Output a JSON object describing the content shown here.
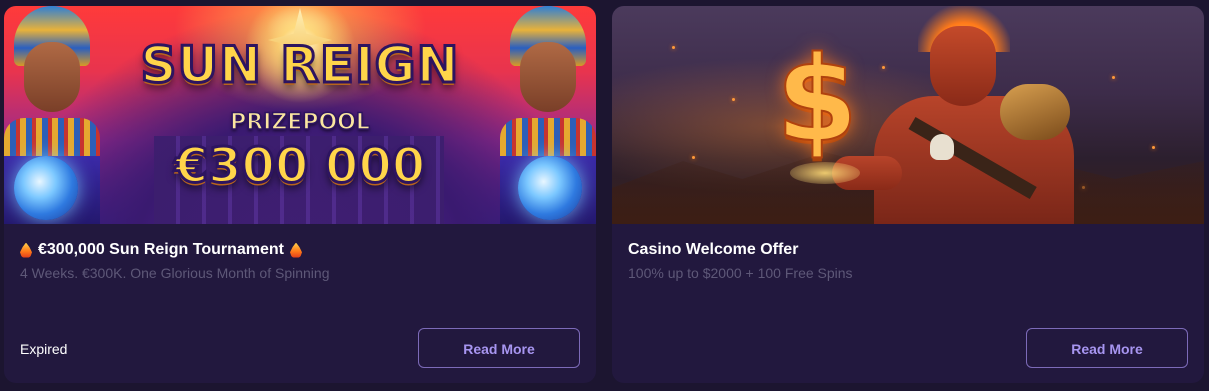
{
  "promotions": [
    {
      "banner": {
        "title": "SUN REIGN",
        "subtitle": "PRIZEPOOL",
        "amount": "€300 000"
      },
      "title": "€300,000 Sun Reign Tournament",
      "description": "4 Weeks. €300K. One Glorious Month of Spinning",
      "status": "Expired",
      "button_label": "Read More",
      "title_icon": "flame-icon"
    },
    {
      "banner": {
        "symbol": "$"
      },
      "title": "Casino Welcome Offer",
      "description": "100% up to $2000 + 100 Free Spins",
      "status": "",
      "button_label": "Read More"
    }
  ],
  "colors": {
    "background": "#1c1530",
    "card": "#22183e",
    "muted_text": "#5e5878",
    "button_border": "#7c6ab8",
    "button_text": "#a795f0"
  }
}
